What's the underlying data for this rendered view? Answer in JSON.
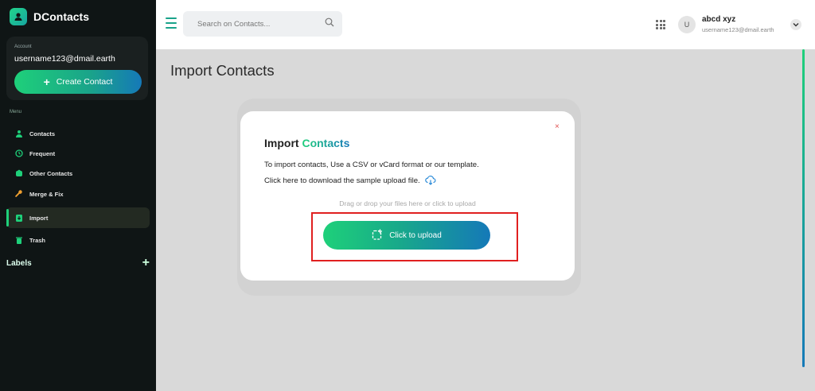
{
  "app": {
    "name": "DContacts"
  },
  "sidebar": {
    "account_caption": "Account",
    "account_email": "username123@dmail.earth",
    "create_label": "Create Contact",
    "menu_caption": "Menu",
    "items": [
      {
        "label": "Contacts",
        "icon": "person-icon"
      },
      {
        "label": "Frequent",
        "icon": "history-icon"
      },
      {
        "label": "Other Contacts",
        "icon": "contacts-box-icon"
      },
      {
        "label": "Merge & Fix",
        "icon": "wrench-icon"
      },
      {
        "label": "Import",
        "icon": "import-icon",
        "active": true
      },
      {
        "label": "Trash",
        "icon": "trash-icon"
      }
    ],
    "labels_heading": "Labels"
  },
  "header": {
    "search_placeholder": "Search on Contacts...",
    "user": {
      "initial": "U",
      "name": "abcd xyz",
      "email": "username123@dmail.earth"
    }
  },
  "main": {
    "title": "Import Contacts"
  },
  "modal": {
    "title_prefix": "Import",
    "title_accent": "Contacts",
    "close": "×",
    "line1": "To import contacts, Use a CSV or vCard format or our template.",
    "line2": "Click here to download the sample upload file.",
    "drop_hint": "Drag or drop your files here or click to upload",
    "upload_label": "Click to upload"
  },
  "colors": {
    "accent_green": "#1ed07a",
    "accent_blue": "#1579b8",
    "highlight_red": "#e02020"
  }
}
